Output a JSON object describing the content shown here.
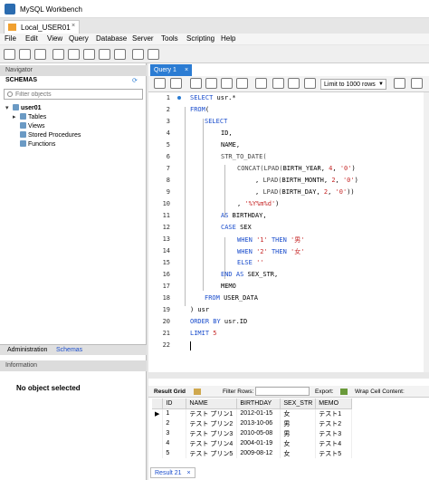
{
  "window": {
    "title": "MySQL Workbench"
  },
  "connection_tab": {
    "label": "Local_USER01",
    "close": "×"
  },
  "menu": [
    "File",
    "Edit",
    "View",
    "Query",
    "Database",
    "Server",
    "Tools",
    "Scripting",
    "Help"
  ],
  "navigator": {
    "header": "Navigator",
    "schemas_label": "SCHEMAS",
    "filter_placeholder": "Filter objects",
    "tree": {
      "schema": "user01",
      "children": [
        "Tables",
        "Views",
        "Stored Procedures",
        "Functions"
      ]
    },
    "lower_tabs": [
      "Administration",
      "Schemas"
    ],
    "info_header": "Information",
    "info_text": "No object selected"
  },
  "query_tab": {
    "label": "Query 1",
    "close": "×"
  },
  "toolbar": {
    "limit_label": "Limit to 1000 rows"
  },
  "editor": {
    "line_numbers": [
      "1",
      "2",
      "3",
      "4",
      "5",
      "6",
      "7",
      "8",
      "9",
      "10",
      "11",
      "12",
      "13",
      "14",
      "15",
      "16",
      "17",
      "18",
      "19",
      "20",
      "21",
      "22"
    ]
  },
  "results": {
    "result_grid_label": "Result Grid",
    "filter_rows_label": "Filter Rows:",
    "export_label": "Export:",
    "wrap_label": "Wrap Cell Content:",
    "columns": [
      "ID",
      "NAME",
      "BIRTHDAY",
      "SEX_STR",
      "MEMO"
    ],
    "rows": [
      [
        "1",
        "テスト プリン1",
        "2012-01-15",
        "女",
        "テスト1"
      ],
      [
        "2",
        "テスト プリン2",
        "2013-10-06",
        "男",
        "テスト2"
      ],
      [
        "3",
        "テスト プリン3",
        "2010-05-08",
        "男",
        "テスト3"
      ],
      [
        "4",
        "テスト プリン4",
        "2004-01-19",
        "女",
        "テスト4"
      ],
      [
        "5",
        "テスト プリン5",
        "2009-08-12",
        "女",
        "テスト5"
      ]
    ],
    "result_tab": "Result 21",
    "result_tab_close": "×"
  },
  "colors": {
    "accent": "#2b7cd3",
    "keyword": "#1a4dcc",
    "string": "#c62828"
  }
}
